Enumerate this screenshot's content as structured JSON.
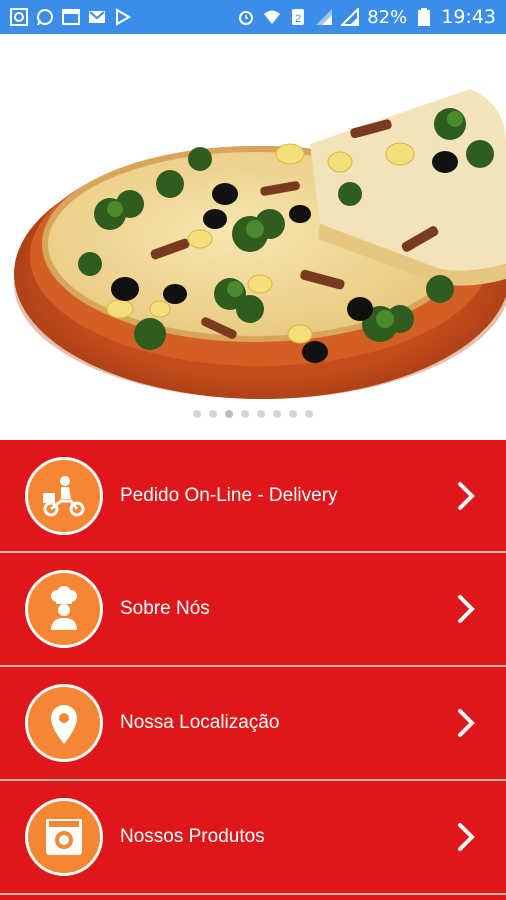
{
  "status_bar": {
    "battery": "82%",
    "time": "19:43",
    "color": "#3b8de7",
    "left_icons": [
      "gallery-icon",
      "whatsapp-icon",
      "window-icon",
      "gmail-icon",
      "play-store-icon"
    ],
    "right_icons": [
      "alarm-icon",
      "wifi-icon",
      "sim-icon",
      "signal-icon",
      "signal-icon",
      "battery-icon"
    ]
  },
  "hero": {
    "image": "pizza-photo",
    "carousel_dots": 8,
    "active_dot": 2
  },
  "menu": {
    "background": "#e0171a",
    "icon_circle_color": "#f58634",
    "items": [
      {
        "label": "Pedido On-Line - Delivery",
        "icon": "delivery-scooter-icon"
      },
      {
        "label": "Sobre Nós",
        "icon": "chef-icon"
      },
      {
        "label": "Nossa Localização",
        "icon": "location-pin-icon"
      },
      {
        "label": "Nossos Produtos",
        "icon": "camera-icon"
      }
    ]
  }
}
